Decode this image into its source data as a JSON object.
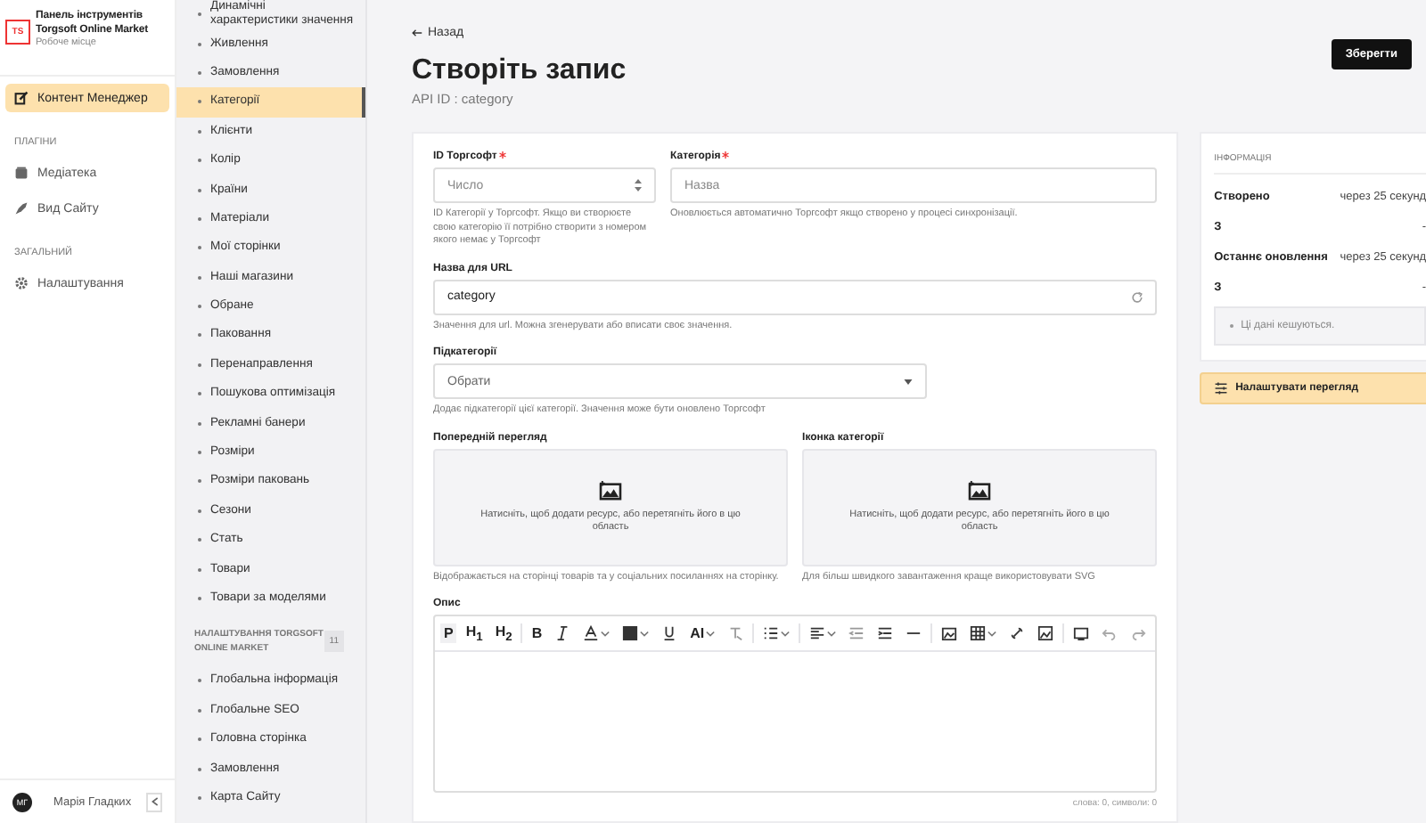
{
  "brand": {
    "logo": "TS",
    "title": "Панель інструментів Torgsoft Online Market",
    "subtitle": "Робоче місце"
  },
  "sidebar": {
    "items": [
      {
        "kind": "item",
        "label": "Контент Менеджер",
        "selected": true
      },
      {
        "kind": "section",
        "label": "ПЛАГІНИ"
      },
      {
        "kind": "item",
        "label": "Медіатека",
        "selected": false
      },
      {
        "kind": "item",
        "label": "Вид Сайту",
        "selected": false
      },
      {
        "kind": "section",
        "label": "ЗАГАЛЬНИЙ"
      },
      {
        "kind": "item",
        "label": "Налаштування",
        "selected": false
      }
    ]
  },
  "user": {
    "initials": "МГ",
    "name": "Марія Гладких"
  },
  "collection_nav": {
    "items": [
      {
        "label": "Динамічні характеристики значення",
        "selected": false
      },
      {
        "label": "Живлення",
        "selected": false
      },
      {
        "label": "Замовлення",
        "selected": false
      },
      {
        "label": "Категорії",
        "selected": true
      },
      {
        "label": "Клієнти",
        "selected": false
      },
      {
        "label": "Колір",
        "selected": false
      },
      {
        "label": "Країни",
        "selected": false
      },
      {
        "label": "Матеріали",
        "selected": false
      },
      {
        "label": "Мої сторінки",
        "selected": false
      },
      {
        "label": "Наші магазини",
        "selected": false
      },
      {
        "label": "Обране",
        "selected": false
      },
      {
        "label": "Паковання",
        "selected": false
      },
      {
        "label": "Перенаправлення",
        "selected": false
      },
      {
        "label": "Пошукова оптимізація",
        "selected": false
      },
      {
        "label": "Рекламні банери",
        "selected": false
      },
      {
        "label": "Розміри",
        "selected": false
      },
      {
        "label": "Розміри паковань",
        "selected": false
      },
      {
        "label": "Сезони",
        "selected": false
      },
      {
        "label": "Стать",
        "selected": false
      },
      {
        "label": "Товари",
        "selected": false
      },
      {
        "label": "Товари за моделями",
        "selected": false
      }
    ],
    "section": {
      "title": "НАЛАШТУВАННЯ TORGSOFT ONLINE MARKET",
      "count": "11"
    },
    "section_items": [
      {
        "label": "Глобальна інформація",
        "selected": false
      },
      {
        "label": "Глобальне SEO",
        "selected": false
      },
      {
        "label": "Головна сторінка",
        "selected": false
      },
      {
        "label": "Замовлення",
        "selected": false
      },
      {
        "label": "Карта Сайту",
        "selected": false
      }
    ]
  },
  "header": {
    "back": "Назад",
    "title": "Створіть запис",
    "api_id": "API ID : category",
    "save": "Зберегти"
  },
  "form": {
    "id_field": {
      "label": "ID Торгсофт",
      "required": true,
      "placeholder": "Число",
      "hint": "ID Категорії у Торгсофт. Якщо ви створюєте свою категорію її потрібно створити з номером якого немає у Торгсофт"
    },
    "name_field": {
      "label": "Категорія",
      "required": true,
      "placeholder": "Назва",
      "hint": "Оновлюється автоматично Торгсофт якщо створено у процесі синхронізації."
    },
    "url_field": {
      "label": "Назва для URL",
      "value": "category",
      "hint": "Значення для url. Можна згенерувати або вписати своє значення."
    },
    "subcategories": {
      "label": "Підкатегорії",
      "placeholder": "Обрати",
      "hint": "Додає підкатегорії цієї категорії. Значення може бути оновлено Торгсофт"
    },
    "media": [
      {
        "label": "Попередній перегляд",
        "prompt": "Натисніть, щоб додати ресурс, або перетягніть його в цю область",
        "hint": "Відображається на сторінці товарів та у соціальних посиланнях на сторінку."
      },
      {
        "label": "Іконка категорії",
        "prompt": "Натисніть, щоб додати ресурс, або перетягніть його в цю область",
        "hint": "Для більш швидкого завантаження краще використовувати SVG"
      }
    ],
    "description": {
      "label": "Опис",
      "counter": "слова: 0, символи: 0",
      "toolbar": [
        {
          "kind": "text",
          "label": "P",
          "selected": true
        },
        {
          "kind": "text",
          "label": "H$_{1}$",
          "selected": false
        },
        {
          "kind": "text",
          "label": "H$_{2}$",
          "selected": false
        },
        {
          "kind": "sep"
        },
        {
          "kind": "text",
          "label": "B",
          "selected": false
        },
        {
          "kind": "icon"
        },
        {
          "kind": "icon",
          "caret": true
        },
        {
          "kind": "icon",
          "caret": true
        },
        {
          "kind": "icon"
        },
        {
          "kind": "text",
          "label": "AI",
          "selected": false,
          "caret": true
        },
        {
          "kind": "icon"
        },
        {
          "kind": "sep"
        },
        {
          "kind": "icon",
          "caret": true
        },
        {
          "kind": "sep"
        },
        {
          "kind": "icon",
          "caret": true
        },
        {
          "kind": "icon"
        },
        {
          "kind": "icon"
        },
        {
          "kind": "icon"
        },
        {
          "kind": "sep"
        },
        {
          "kind": "icon"
        },
        {
          "kind": "icon",
          "caret": true
        },
        {
          "kind": "icon"
        },
        {
          "kind": "icon"
        },
        {
          "kind": "sep"
        },
        {
          "kind": "icon"
        },
        {
          "kind": "icon"
        },
        {
          "kind": "icon"
        }
      ]
    }
  },
  "info": {
    "title": "ІНФОРМАЦІЯ",
    "rows": [
      {
        "label": "Створено",
        "value": "через 25 секунд"
      },
      {
        "label": "З",
        "value": "-"
      },
      {
        "label": "Останнє оновлення",
        "value": "через 25 секунд"
      },
      {
        "label": "З",
        "value": "-"
      }
    ],
    "note": "Ці дані кешуються.",
    "configure": "Налаштувати перегляд"
  }
}
